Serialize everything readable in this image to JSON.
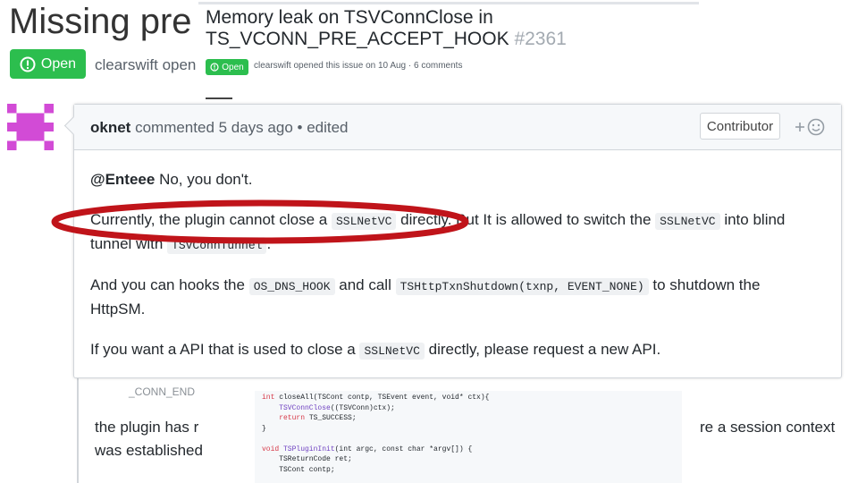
{
  "background": {
    "title": "Missing pre",
    "open_label": "Open",
    "author_fragment": "clearswift open"
  },
  "issue": {
    "title_part1": "Memory leak on TSVConnClose in",
    "title_part2": "TS_VCONN_PRE_ACCEPT_HOOK",
    "number": "#2361",
    "state": "Open",
    "meta": "clearswift opened this issue on 10 Aug · 6 comments"
  },
  "comment": {
    "author": "oknet",
    "header_suffix": "commented 5 days ago • edited",
    "badge": "Contributor",
    "reaction_icon": "smiley-add-icon",
    "line1_mention": "@Enteee",
    "line1_text": "No, you don't.",
    "line2_a": "Currently, the plugin cannot close a",
    "line2_code1": "SSLNetVC",
    "line2_b": "directly. But It is allowed to switch the",
    "line2_code2": "SSLNetVC",
    "line2_c": "into blind",
    "line3_a": "tunnel with",
    "line3_code": "TSVConnTunnel",
    "line3_b": ".",
    "line4_a": "And you can hooks the",
    "line4_code1": "OS_DNS_HOOK",
    "line4_b": "and call",
    "line4_code2": "TSHttpTxnShutdown(txnp, EVENT_NONE)",
    "line4_c": "to shutdown the",
    "line5": "HttpSM.",
    "line6_a": "If you want a API that is used to close a",
    "line6_code": "SSLNetVC",
    "line6_b": "directly, please request a new API."
  },
  "bottom": {
    "fragment": "_CONN_END",
    "text1": "the plugin has r",
    "text2": "was established",
    "text3": "re a session context"
  },
  "code": {
    "l1_kw": "int",
    "l1_rest": " closeAll(TSCont contp, TSEvent event, void* ctx){",
    "l2_fn": "    TSVConnClose",
    "l2_rest": "((TSVConn)ctx);",
    "l3_kw": "    return",
    "l3_rest": " TS_SUCCESS;",
    "l4": "}",
    "l5_kw": "void",
    "l5_fn": " TSPluginInit",
    "l5_rest": "(int argc, const char *argv[]) {",
    "l6": "    TSReturnCode ret;",
    "l7": "    TSCont contp;"
  },
  "colors": {
    "open_green": "#2cbe4e",
    "annotation_red": "#c0141a",
    "avatar_magenta": "#d24bd6"
  }
}
